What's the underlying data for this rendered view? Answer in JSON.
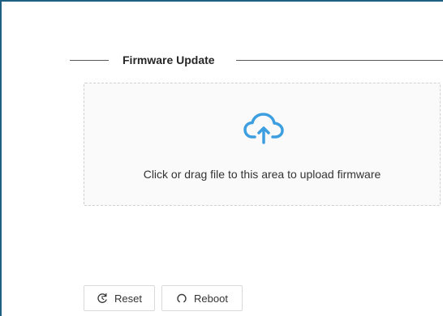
{
  "section": {
    "title": "Firmware Update"
  },
  "upload": {
    "hint": "Click or drag file to this area to upload firmware",
    "icon": "cloud-upload-icon",
    "icon_color": "#3e9fe0"
  },
  "actions": {
    "reset_label": "Reset",
    "reset_icon": "reset-icon",
    "reboot_label": "Reboot",
    "reboot_icon": "reboot-icon"
  },
  "colors": {
    "frame_border": "#1f5f82",
    "accent": "#3e9fe0"
  }
}
